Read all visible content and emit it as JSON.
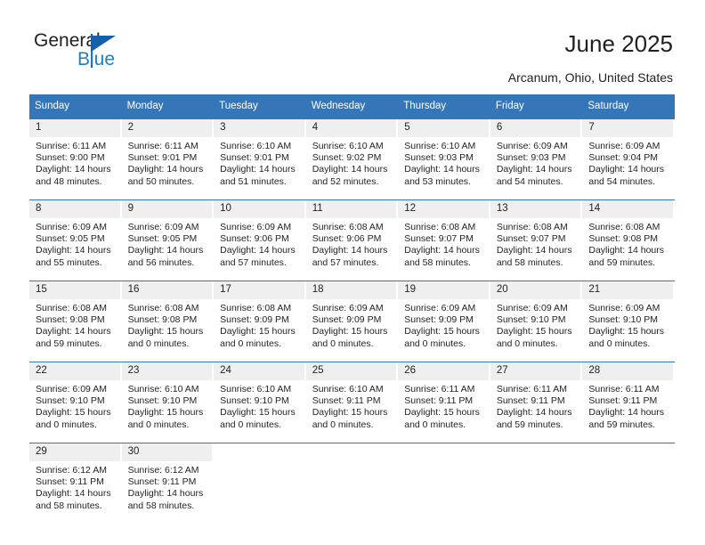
{
  "brand": {
    "name_part1": "General",
    "name_part2": "Blue",
    "accent_color": "#1560a8",
    "logo_icon": "triangle-flag-icon"
  },
  "header": {
    "title": "June 2025",
    "location": "Arcanum, Ohio, United States"
  },
  "calendar": {
    "header_color": "#3576b8",
    "daynum_band_color": "#efefef",
    "weekday_headers": [
      "Sunday",
      "Monday",
      "Tuesday",
      "Wednesday",
      "Thursday",
      "Friday",
      "Saturday"
    ],
    "weeks": [
      [
        {
          "day": "1",
          "sunrise": "Sunrise: 6:11 AM",
          "sunset": "Sunset: 9:00 PM",
          "daylight_line1": "Daylight: 14 hours",
          "daylight_line2": "and 48 minutes."
        },
        {
          "day": "2",
          "sunrise": "Sunrise: 6:11 AM",
          "sunset": "Sunset: 9:01 PM",
          "daylight_line1": "Daylight: 14 hours",
          "daylight_line2": "and 50 minutes."
        },
        {
          "day": "3",
          "sunrise": "Sunrise: 6:10 AM",
          "sunset": "Sunset: 9:01 PM",
          "daylight_line1": "Daylight: 14 hours",
          "daylight_line2": "and 51 minutes."
        },
        {
          "day": "4",
          "sunrise": "Sunrise: 6:10 AM",
          "sunset": "Sunset: 9:02 PM",
          "daylight_line1": "Daylight: 14 hours",
          "daylight_line2": "and 52 minutes."
        },
        {
          "day": "5",
          "sunrise": "Sunrise: 6:10 AM",
          "sunset": "Sunset: 9:03 PM",
          "daylight_line1": "Daylight: 14 hours",
          "daylight_line2": "and 53 minutes."
        },
        {
          "day": "6",
          "sunrise": "Sunrise: 6:09 AM",
          "sunset": "Sunset: 9:03 PM",
          "daylight_line1": "Daylight: 14 hours",
          "daylight_line2": "and 54 minutes."
        },
        {
          "day": "7",
          "sunrise": "Sunrise: 6:09 AM",
          "sunset": "Sunset: 9:04 PM",
          "daylight_line1": "Daylight: 14 hours",
          "daylight_line2": "and 54 minutes."
        }
      ],
      [
        {
          "day": "8",
          "sunrise": "Sunrise: 6:09 AM",
          "sunset": "Sunset: 9:05 PM",
          "daylight_line1": "Daylight: 14 hours",
          "daylight_line2": "and 55 minutes."
        },
        {
          "day": "9",
          "sunrise": "Sunrise: 6:09 AM",
          "sunset": "Sunset: 9:05 PM",
          "daylight_line1": "Daylight: 14 hours",
          "daylight_line2": "and 56 minutes."
        },
        {
          "day": "10",
          "sunrise": "Sunrise: 6:09 AM",
          "sunset": "Sunset: 9:06 PM",
          "daylight_line1": "Daylight: 14 hours",
          "daylight_line2": "and 57 minutes."
        },
        {
          "day": "11",
          "sunrise": "Sunrise: 6:08 AM",
          "sunset": "Sunset: 9:06 PM",
          "daylight_line1": "Daylight: 14 hours",
          "daylight_line2": "and 57 minutes."
        },
        {
          "day": "12",
          "sunrise": "Sunrise: 6:08 AM",
          "sunset": "Sunset: 9:07 PM",
          "daylight_line1": "Daylight: 14 hours",
          "daylight_line2": "and 58 minutes."
        },
        {
          "day": "13",
          "sunrise": "Sunrise: 6:08 AM",
          "sunset": "Sunset: 9:07 PM",
          "daylight_line1": "Daylight: 14 hours",
          "daylight_line2": "and 58 minutes."
        },
        {
          "day": "14",
          "sunrise": "Sunrise: 6:08 AM",
          "sunset": "Sunset: 9:08 PM",
          "daylight_line1": "Daylight: 14 hours",
          "daylight_line2": "and 59 minutes."
        }
      ],
      [
        {
          "day": "15",
          "sunrise": "Sunrise: 6:08 AM",
          "sunset": "Sunset: 9:08 PM",
          "daylight_line1": "Daylight: 14 hours",
          "daylight_line2": "and 59 minutes."
        },
        {
          "day": "16",
          "sunrise": "Sunrise: 6:08 AM",
          "sunset": "Sunset: 9:08 PM",
          "daylight_line1": "Daylight: 15 hours",
          "daylight_line2": "and 0 minutes."
        },
        {
          "day": "17",
          "sunrise": "Sunrise: 6:08 AM",
          "sunset": "Sunset: 9:09 PM",
          "daylight_line1": "Daylight: 15 hours",
          "daylight_line2": "and 0 minutes."
        },
        {
          "day": "18",
          "sunrise": "Sunrise: 6:09 AM",
          "sunset": "Sunset: 9:09 PM",
          "daylight_line1": "Daylight: 15 hours",
          "daylight_line2": "and 0 minutes."
        },
        {
          "day": "19",
          "sunrise": "Sunrise: 6:09 AM",
          "sunset": "Sunset: 9:09 PM",
          "daylight_line1": "Daylight: 15 hours",
          "daylight_line2": "and 0 minutes."
        },
        {
          "day": "20",
          "sunrise": "Sunrise: 6:09 AM",
          "sunset": "Sunset: 9:10 PM",
          "daylight_line1": "Daylight: 15 hours",
          "daylight_line2": "and 0 minutes."
        },
        {
          "day": "21",
          "sunrise": "Sunrise: 6:09 AM",
          "sunset": "Sunset: 9:10 PM",
          "daylight_line1": "Daylight: 15 hours",
          "daylight_line2": "and 0 minutes."
        }
      ],
      [
        {
          "day": "22",
          "sunrise": "Sunrise: 6:09 AM",
          "sunset": "Sunset: 9:10 PM",
          "daylight_line1": "Daylight: 15 hours",
          "daylight_line2": "and 0 minutes."
        },
        {
          "day": "23",
          "sunrise": "Sunrise: 6:10 AM",
          "sunset": "Sunset: 9:10 PM",
          "daylight_line1": "Daylight: 15 hours",
          "daylight_line2": "and 0 minutes."
        },
        {
          "day": "24",
          "sunrise": "Sunrise: 6:10 AM",
          "sunset": "Sunset: 9:10 PM",
          "daylight_line1": "Daylight: 15 hours",
          "daylight_line2": "and 0 minutes."
        },
        {
          "day": "25",
          "sunrise": "Sunrise: 6:10 AM",
          "sunset": "Sunset: 9:11 PM",
          "daylight_line1": "Daylight: 15 hours",
          "daylight_line2": "and 0 minutes."
        },
        {
          "day": "26",
          "sunrise": "Sunrise: 6:11 AM",
          "sunset": "Sunset: 9:11 PM",
          "daylight_line1": "Daylight: 15 hours",
          "daylight_line2": "and 0 minutes."
        },
        {
          "day": "27",
          "sunrise": "Sunrise: 6:11 AM",
          "sunset": "Sunset: 9:11 PM",
          "daylight_line1": "Daylight: 14 hours",
          "daylight_line2": "and 59 minutes."
        },
        {
          "day": "28",
          "sunrise": "Sunrise: 6:11 AM",
          "sunset": "Sunset: 9:11 PM",
          "daylight_line1": "Daylight: 14 hours",
          "daylight_line2": "and 59 minutes."
        }
      ],
      [
        {
          "day": "29",
          "sunrise": "Sunrise: 6:12 AM",
          "sunset": "Sunset: 9:11 PM",
          "daylight_line1": "Daylight: 14 hours",
          "daylight_line2": "and 58 minutes."
        },
        {
          "day": "30",
          "sunrise": "Sunrise: 6:12 AM",
          "sunset": "Sunset: 9:11 PM",
          "daylight_line1": "Daylight: 14 hours",
          "daylight_line2": "and 58 minutes."
        },
        {
          "day": "",
          "sunrise": "",
          "sunset": "",
          "daylight_line1": "",
          "daylight_line2": ""
        },
        {
          "day": "",
          "sunrise": "",
          "sunset": "",
          "daylight_line1": "",
          "daylight_line2": ""
        },
        {
          "day": "",
          "sunrise": "",
          "sunset": "",
          "daylight_line1": "",
          "daylight_line2": ""
        },
        {
          "day": "",
          "sunrise": "",
          "sunset": "",
          "daylight_line1": "",
          "daylight_line2": ""
        },
        {
          "day": "",
          "sunrise": "",
          "sunset": "",
          "daylight_line1": "",
          "daylight_line2": ""
        }
      ]
    ]
  }
}
